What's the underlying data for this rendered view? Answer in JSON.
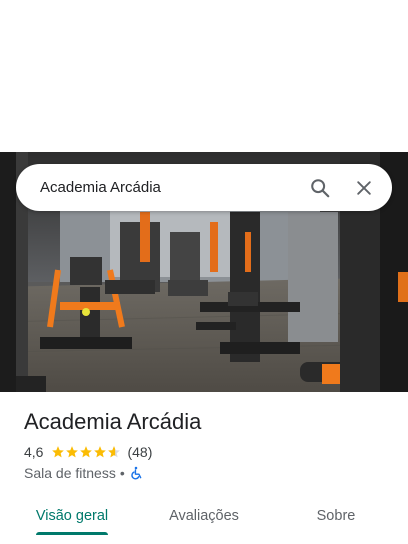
{
  "search": {
    "query": "Academia Arcádia",
    "icons": {
      "search": "search-icon",
      "close": "close-icon"
    }
  },
  "photo": {
    "description_icon": "gym-photo"
  },
  "place": {
    "name": "Academia Arcádia",
    "rating": "4,6",
    "rating_value": 4.6,
    "review_count": "(48)",
    "category": "Sala de fitness",
    "separator": "•",
    "accessibility_icon": "wheelchair-accessible-icon"
  },
  "tabs": [
    {
      "label": "Visão geral",
      "active": true
    },
    {
      "label": "Avaliações",
      "active": false
    },
    {
      "label": "Sobre",
      "active": false
    }
  ],
  "colors": {
    "accent": "#00796b",
    "star": "#fbbc04",
    "accessibility_icon": "#1a73e8",
    "text_primary": "#202124",
    "text_secondary": "#5f6368"
  }
}
